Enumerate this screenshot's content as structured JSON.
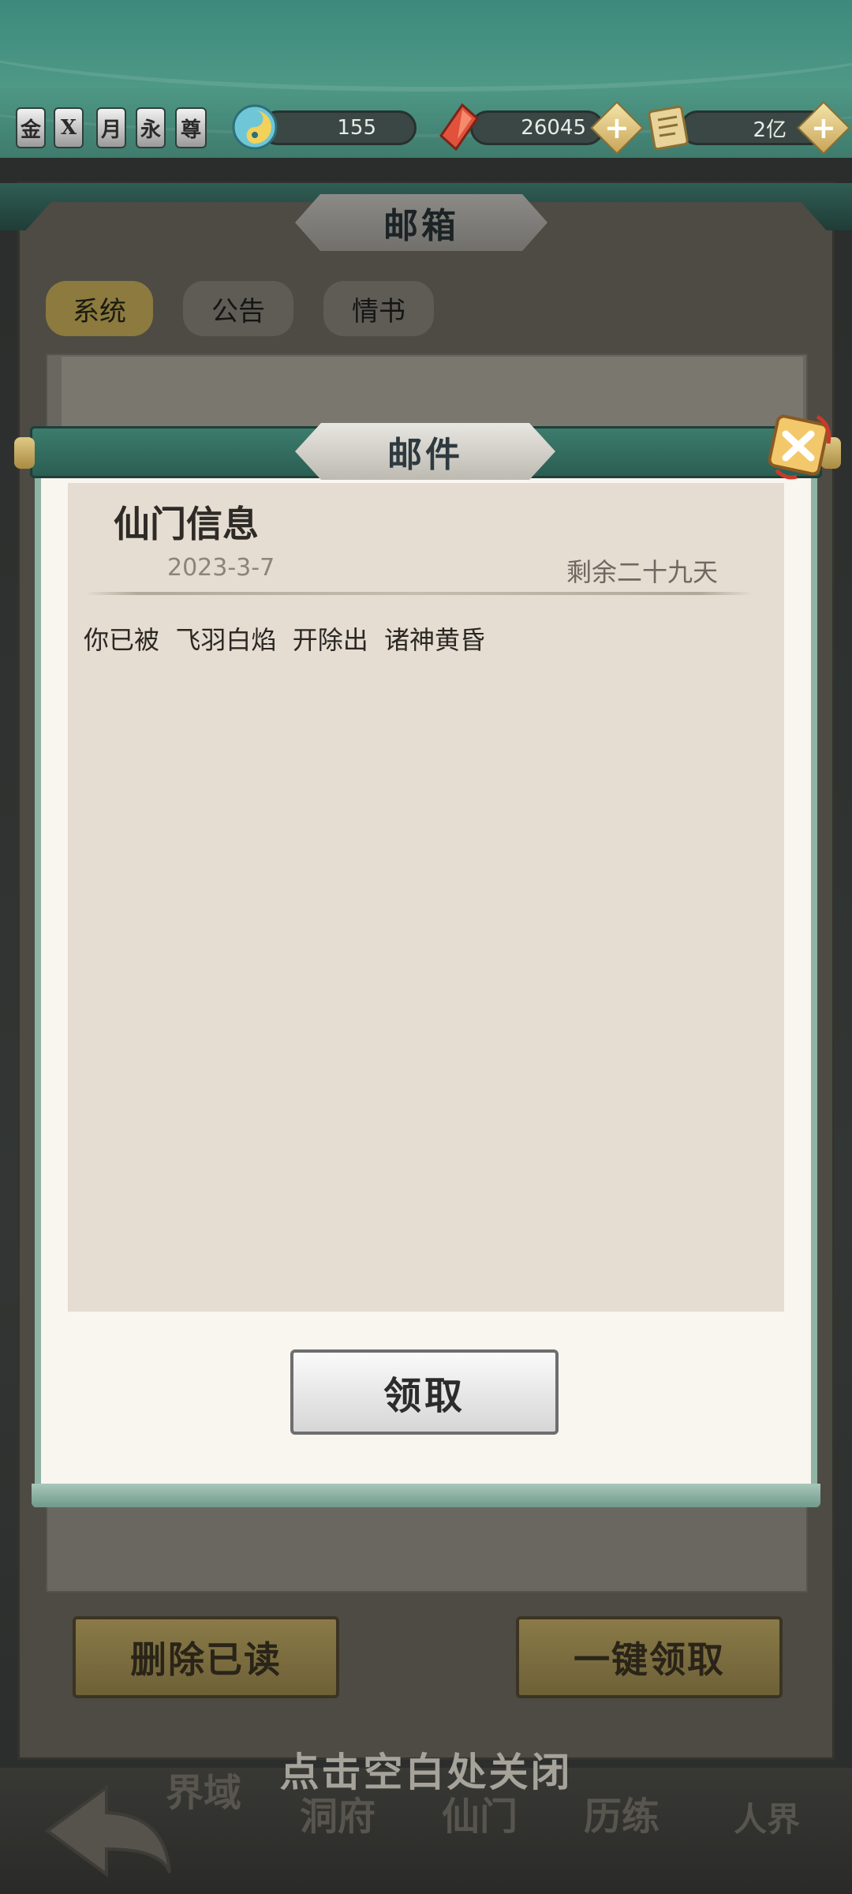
{
  "header": {
    "badges": [
      "金",
      "X",
      "月",
      "永",
      "尊"
    ],
    "resources": [
      {
        "icon": "jade-swirl-icon",
        "value": "155"
      },
      {
        "icon": "red-gem-icon",
        "value": "26045"
      },
      {
        "icon": "scroll-paper-icon",
        "value": "2亿"
      }
    ]
  },
  "mailbox": {
    "title": "邮箱",
    "tabs": [
      {
        "label": "系统",
        "active": true
      },
      {
        "label": "公告",
        "active": false
      },
      {
        "label": "情书",
        "active": false
      }
    ],
    "delete_read_label": "删除已读",
    "claim_all_label": "一键领取",
    "close_hint": "点击空白处关闭"
  },
  "modal": {
    "title": "邮件",
    "mail_title": "仙门信息",
    "date": "2023-3-7",
    "remaining": "剩余二十九天",
    "body": "你已被  飞羽白焰  开除出  诸神黄昏",
    "claim_label": "领取"
  },
  "nav": {
    "labels": [
      "界域",
      "洞府",
      "仙门",
      "历练",
      "人界"
    ]
  },
  "colors": {
    "header_teal": "#4e9886",
    "modal_paper": "#f8f6ef",
    "content_paper": "#e5ddd2",
    "gold_button": "#8a7a48"
  }
}
